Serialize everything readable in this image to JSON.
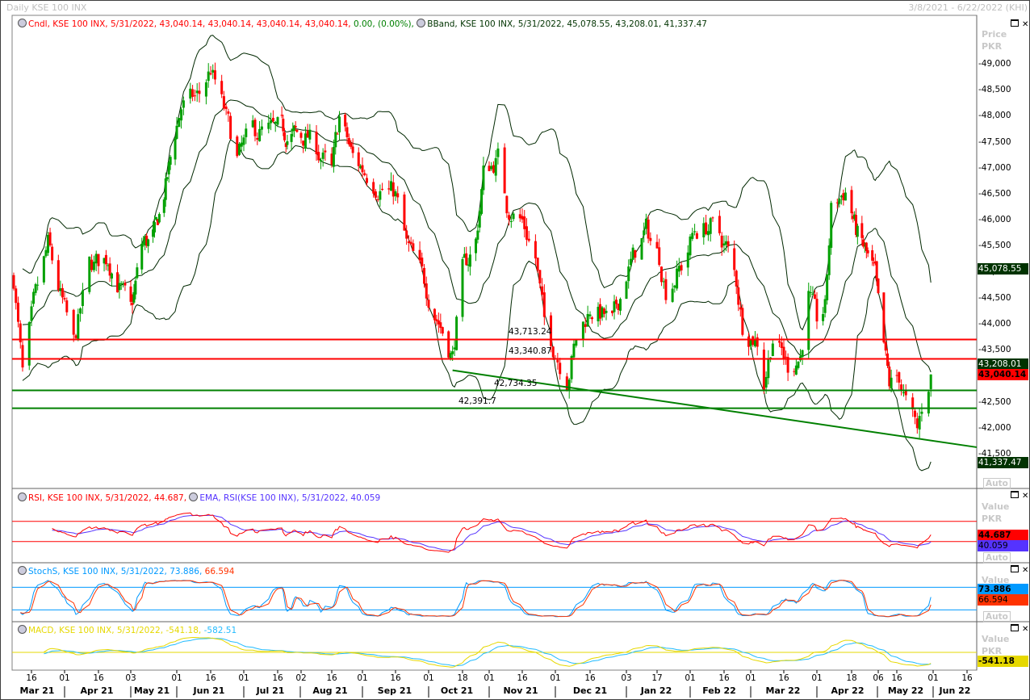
{
  "window": {
    "title": "Daily KSE 100 INX",
    "range": "3/8/2021 - 6/22/2022 (KHI)"
  },
  "legends": {
    "cndl": "Cndl, KSE 100 INX, 5/31/2022, 43,040.14, 43,040.14, 43,040.14, 43,040.14,",
    "change": "0.00, (0.00%),",
    "bband": "BBand, KSE 100 INX, 5/31/2022, 45,078.55, 43,208.01, 41,337.47",
    "rsi": "RSI, KSE 100 INX, 5/31/2022, 44.687,",
    "ema": "EMA, RSI(KSE 100 INX), 5/31/2022, 40.059",
    "stoch": "StochS, KSE 100 INX, 5/31/2022, 73.886,",
    "stoch_d": "66.594",
    "macd": "MACD, KSE 100 INX, 5/31/2022, -541.18,",
    "macd_signal": "-582.51"
  },
  "axes": {
    "price_title": "Price",
    "price_unit": "PKR",
    "value_title": "Value",
    "value_unit": "PKR",
    "auto_label": "Auto",
    "price_ticks": [
      "49,000",
      "48,500",
      "48,000",
      "47,500",
      "47,000",
      "46,500",
      "46,000",
      "45,500",
      "45,000",
      "44,500",
      "44,000",
      "43,500",
      "43,000",
      "42,500",
      "42,000",
      "41,500"
    ]
  },
  "markers": {
    "bb_upper": "45,078.55",
    "bb_mid": "43,208.01",
    "close": "43,040.14",
    "bb_lower": "41,337.47",
    "rsi": "44.687",
    "rsi_ema": "40.059",
    "stoch_k": "73.886",
    "stoch_d": "66.594",
    "macd": "-541.18"
  },
  "colors": {
    "up": "#00a000",
    "down": "#ff0000",
    "band": "#002800",
    "marker_dark": "#003300",
    "rsi": "#ff0000",
    "rsi_ema": "#5533ff",
    "stoch_k": "#0099ff",
    "stoch_d": "#ff3300",
    "macd": "#e6d800",
    "macd_signal": "#22bbff"
  },
  "x_axis": {
    "day_ticks": [
      [
        "2021-03-16",
        "16"
      ],
      [
        "2021-04-01",
        "01"
      ],
      [
        "2021-04-16",
        "16"
      ],
      [
        "2021-05-03",
        "03"
      ],
      [
        "2021-06-01",
        "01"
      ],
      [
        "2021-06-16",
        "16"
      ],
      [
        "2021-07-01",
        "01"
      ],
      [
        "2021-07-16",
        "16"
      ],
      [
        "2021-08-02",
        "02"
      ],
      [
        "2021-08-16",
        "16"
      ],
      [
        "2021-09-01",
        "01"
      ],
      [
        "2021-09-16",
        "16"
      ],
      [
        "2021-10-01",
        "01"
      ],
      [
        "2021-10-18",
        "18"
      ],
      [
        "2021-11-01",
        "01"
      ],
      [
        "2021-11-16",
        "16"
      ],
      [
        "2021-12-01",
        "01"
      ],
      [
        "2021-12-16",
        "16"
      ],
      [
        "2022-01-03",
        "03"
      ],
      [
        "2022-01-17",
        "17"
      ],
      [
        "2022-02-01",
        "01"
      ],
      [
        "2022-02-16",
        "16"
      ],
      [
        "2022-03-01",
        "01"
      ],
      [
        "2022-03-16",
        "16"
      ],
      [
        "2022-04-01",
        "01"
      ],
      [
        "2022-04-18",
        "18"
      ],
      [
        "2022-05-06",
        "06"
      ],
      [
        "2022-05-16",
        "16"
      ],
      [
        "2022-06-01",
        "01"
      ],
      [
        "2022-06-16",
        "16"
      ]
    ],
    "months": [
      "Mar 21",
      "Apr 21",
      "May 21",
      "Jun 21",
      "Jul 21",
      "Aug 21",
      "Sep 21",
      "Oct 21",
      "Nov 21",
      "Dec 21",
      "Jan 22",
      "Feb 22",
      "Mar 22",
      "Apr 22",
      "May 22",
      "Jun 22"
    ]
  },
  "chart_data": [
    {
      "type": "candlestick",
      "title": "Daily KSE 100 INX",
      "ylabel": "Price PKR",
      "ylim": [
        41000,
        49500
      ],
      "xlim": [
        "2021-03-08",
        "2022-06-22"
      ],
      "close_keypoints": [
        [
          "2021-03-08",
          44900
        ],
        [
          "2021-03-12",
          43000
        ],
        [
          "2021-03-17",
          44300
        ],
        [
          "2021-03-24",
          45500
        ],
        [
          "2021-04-05",
          43600
        ],
        [
          "2021-04-12",
          45100
        ],
        [
          "2021-04-21",
          45300
        ],
        [
          "2021-05-03",
          44200
        ],
        [
          "2021-05-10",
          45500
        ],
        [
          "2021-05-18",
          45700
        ],
        [
          "2021-05-26",
          46800
        ],
        [
          "2021-06-03",
          48200
        ],
        [
          "2021-06-11",
          48400
        ],
        [
          "2021-06-16",
          48900
        ],
        [
          "2021-06-22",
          48100
        ],
        [
          "2021-06-28",
          47200
        ],
        [
          "2021-07-05",
          47700
        ],
        [
          "2021-07-16",
          47700
        ],
        [
          "2021-08-05",
          47600
        ],
        [
          "2021-08-12",
          47200
        ],
        [
          "2021-08-16",
          46900
        ],
        [
          "2021-08-20",
          48000
        ],
        [
          "2021-08-27",
          47200
        ],
        [
          "2021-09-08",
          46700
        ],
        [
          "2021-09-16",
          46500
        ],
        [
          "2021-09-21",
          45500
        ],
        [
          "2021-09-27",
          45000
        ],
        [
          "2021-10-04",
          44300
        ],
        [
          "2021-10-13",
          43400
        ],
        [
          "2021-10-18",
          45000
        ],
        [
          "2021-10-25",
          45600
        ],
        [
          "2021-10-29",
          46900
        ],
        [
          "2021-11-05",
          47200
        ],
        [
          "2021-11-09",
          46300
        ],
        [
          "2021-11-16",
          46000
        ],
        [
          "2021-11-22",
          45300
        ],
        [
          "2021-11-26",
          44000
        ],
        [
          "2021-12-01",
          43500
        ],
        [
          "2021-12-06",
          43000
        ],
        [
          "2021-12-10",
          43700
        ],
        [
          "2021-12-16",
          44300
        ],
        [
          "2021-12-22",
          44200
        ],
        [
          "2021-12-27",
          44000
        ],
        [
          "2022-01-03",
          45000
        ],
        [
          "2022-01-12",
          45800
        ],
        [
          "2022-01-18",
          45300
        ],
        [
          "2022-01-21",
          44700
        ],
        [
          "2022-01-28",
          45100
        ],
        [
          "2022-02-03",
          45800
        ],
        [
          "2022-02-10",
          45900
        ],
        [
          "2022-02-17",
          45500
        ],
        [
          "2022-02-22",
          44800
        ],
        [
          "2022-02-25",
          44000
        ],
        [
          "2022-03-04",
          43700
        ],
        [
          "2022-03-07",
          42900
        ],
        [
          "2022-03-11",
          43800
        ],
        [
          "2022-03-18",
          43200
        ],
        [
          "2022-03-24",
          43400
        ],
        [
          "2022-03-28",
          44600
        ],
        [
          "2022-04-01",
          44000
        ],
        [
          "2022-04-05",
          44300
        ],
        [
          "2022-04-08",
          46200
        ],
        [
          "2022-04-15",
          46600
        ],
        [
          "2022-04-21",
          45800
        ],
        [
          "2022-04-27",
          45400
        ],
        [
          "2022-05-04",
          44900
        ],
        [
          "2022-05-09",
          43500
        ],
        [
          "2022-05-12",
          42800
        ],
        [
          "2022-05-17",
          43000
        ],
        [
          "2022-05-20",
          42500
        ],
        [
          "2022-05-25",
          41900
        ],
        [
          "2022-05-27",
          42400
        ],
        [
          "2022-05-31",
          43040.14
        ]
      ],
      "last": {
        "date": "5/31/2022",
        "open": 43040.14,
        "high": 43040.14,
        "low": 43040.14,
        "close": 43040.14,
        "change": 0.0,
        "change_pct": 0.0
      },
      "bollinger": {
        "upper": 45078.55,
        "middle": 43208.01,
        "lower": 41337.47
      },
      "h_lines": [
        {
          "value": 43713.24,
          "label": "43,713.24",
          "color": "#ff0000"
        },
        {
          "value": 43340.87,
          "label": "43,340.87",
          "color": "#ff0000"
        },
        {
          "value": 42734.35,
          "label": "42,734.35",
          "color": "#008000"
        },
        {
          "value": 42391.7,
          "label": "42,391.7",
          "color": "#008000"
        }
      ],
      "trend_line": {
        "color": "#008000",
        "from": [
          "2021-10-13",
          43120
        ],
        "to": [
          "2022-05-31",
          41770
        ]
      }
    },
    {
      "type": "line",
      "name": "RSI",
      "ylim": [
        0,
        100
      ],
      "levels": [
        70,
        30
      ],
      "last": {
        "rsi": 44.687,
        "ema": 40.059
      }
    },
    {
      "type": "line",
      "name": "StochS",
      "ylim": [
        0,
        100
      ],
      "levels": [
        80,
        20
      ],
      "last": {
        "k": 73.886,
        "d": 66.594
      }
    },
    {
      "type": "line",
      "name": "MACD",
      "levels": [
        0
      ],
      "last": {
        "macd": -541.18,
        "signal": -582.51
      }
    }
  ]
}
